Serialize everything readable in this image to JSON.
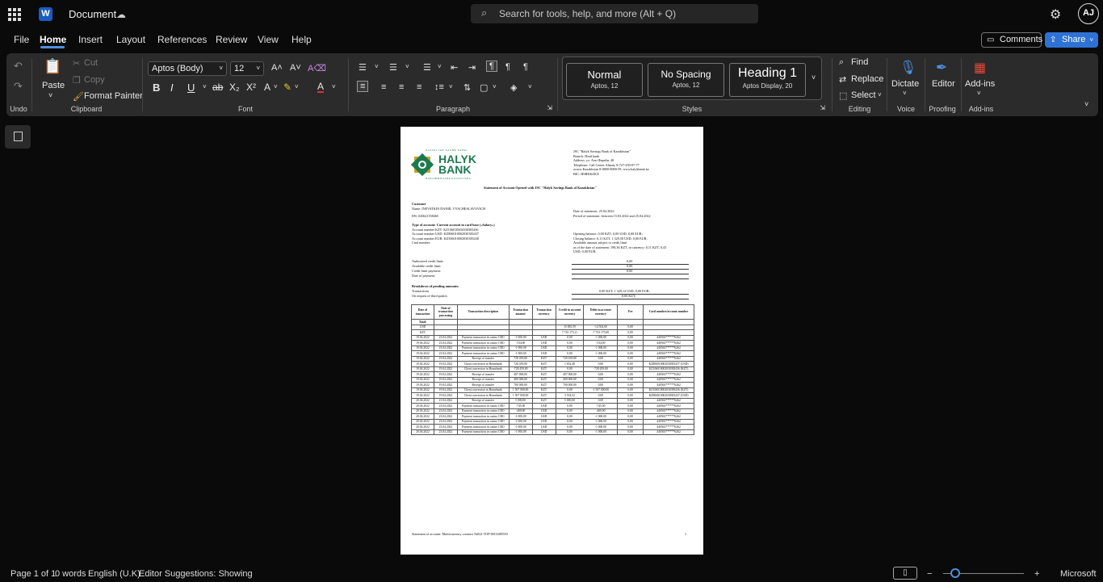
{
  "app": {
    "title": "Document",
    "search_placeholder": "Search for tools, help, and more (Alt + Q)",
    "avatar_initials": "AJ"
  },
  "tabs": [
    "File",
    "Home",
    "Insert",
    "Layout",
    "References",
    "Review",
    "View",
    "Help"
  ],
  "actions": {
    "comments": "Comments",
    "share": "Share"
  },
  "ribbon": {
    "undo_label": "Undo",
    "clipboard": {
      "label": "Clipboard",
      "paste": "Paste",
      "cut": "Cut",
      "copy": "Copy",
      "format_painter": "Format Painter"
    },
    "font": {
      "label": "Font",
      "name": "Aptos (Body)",
      "size": "12"
    },
    "paragraph": {
      "label": "Paragraph"
    },
    "styles": {
      "label": "Styles",
      "items": [
        {
          "name": "Normal",
          "sub": "Aptos, 12"
        },
        {
          "name": "No Spacing",
          "sub": "Aptos, 12"
        },
        {
          "name": "Heading 1",
          "sub": "Aptos Display, 20"
        }
      ]
    },
    "editing": {
      "label": "Editing",
      "find": "Find",
      "replace": "Replace",
      "select": "Select"
    },
    "voice": {
      "label": "Voice",
      "dictate": "Dictate"
    },
    "proofing": {
      "label": "Proofing",
      "editor": "Editor"
    },
    "addins": {
      "label": "Add-ins",
      "btn": "Add-ins"
    }
  },
  "doc": {
    "logo_top": "ҚАЗАҚСТАН ХАЛЫҚ БАНКІ",
    "logo_line1": "HALYK",
    "logo_line2": "BANK",
    "logo_bottom": "НАРОДНЫЙ БАНК КАЗАХСТАНА",
    "bank_info": [
      "JSC \"Halyk Savings Bank of Kazakhstan\"",
      "Branch: Head bank",
      "Address: ул. Аль-Фараби, 40",
      "Telephone: Call Center Almaty 8-727-259-07-77",
      "across Kazakhstan 8-0800-8000-59, www.halykbank.kz",
      "BIC: HSBKKZKX"
    ],
    "heading": "Statement of Account Opened with JSC \"Halyk Savings Bank of Kazakhstan\"",
    "customer": [
      "Customer",
      "Name: INEVATKIN DANIIL VYACHESLAVOVICH",
      "IIN: 020621558465"
    ],
    "date_statement": "Date of statement: 25.04.2022",
    "period": "Period of statement: between 15.03.2022 and 25.04.2022",
    "account_type": "Type of account: Current account in card base («Salary»)",
    "accounts": [
      "Account number KZT: KZ106010002030383436",
      "Account number USD: KZ806010002030383437",
      "Account number EUR: KZ506010002030383438",
      "Card number:"
    ],
    "balances": [
      "Opening balance: 0,00 KZT; 0,00 USD; 0,00 EUR;",
      "Closing balance: 0,11 KZT; 1 329,58 USD; 0,00 EUR;",
      "Available amount subject to credit limit",
      "as of the date of statement: 198,36 KZT, in currency: 0,11 KZT; 0,43",
      "USD; 0,00 EUR;"
    ],
    "credit_labels": [
      "Authorized credit limit:",
      "Available credit limit:",
      "Credit limit payment:",
      "Date of payment:"
    ],
    "credit_values": [
      "0,00",
      "0,00",
      "0,00",
      ""
    ],
    "pending_title": "Breakdown of pending amounts:",
    "pending_labels": [
      "Transactions",
      "On request of third parties"
    ],
    "pending_values": [
      "0,00 KZT; 1 329,14 USD; 0,00 EUR;",
      "0,00 KZT;"
    ],
    "table_headers": [
      "Date of transaction",
      "Date of transaction processing",
      "Transaction description",
      "Transaction amount",
      "Transaction currency",
      "Credit in account currency",
      "Debit in account currency",
      "Fee",
      "Card number/account number"
    ],
    "total_label": "Total:",
    "totals": [
      [
        "USD",
        "",
        "",
        "",
        "",
        "15 835,59",
        "-14 504,00",
        "0,00",
        ""
      ],
      [
        "KZT",
        "",
        "",
        "",
        "",
        "7 733 175,11",
        "-7 733 175,00",
        "0,00",
        ""
      ]
    ],
    "rows": [
      [
        "19.04.2022",
        "23.04.2022",
        "Payment transaction in casino CRO",
        "-1 000,00",
        "USD",
        "0,00",
        "-1 000,00",
        "0,00",
        "440563******6262"
      ],
      [
        "19.04.2022",
        "23.04.2022",
        "Payment transaction in casino CRO",
        "-534,00",
        "USD",
        "0,00",
        "-534,00",
        "0,00",
        "440563******6262"
      ],
      [
        "19.04.2022",
        "23.04.2022",
        "Payment transaction in casino CRO",
        "-1 000,00",
        "USD",
        "0,00",
        "-1 000,00",
        "0,00",
        "440563******6262"
      ],
      [
        "19.04.2022",
        "23.04.2022",
        "Payment transaction in casino CRO",
        "-1 000,00",
        "USD",
        "0,00",
        "-1 000,00",
        "0,00",
        "440563******6262"
      ],
      [
        "19.04.2022",
        "19.04.2022",
        "Receipt of transfer",
        "728 459,00",
        "KZT",
        "728 459,00",
        "0,00",
        "0,00",
        "440563******6262"
      ],
      [
        "19.04.2022",
        "19.04.2022",
        "Client conversion in Homebank",
        "728 459,00",
        "KZT",
        "1 652,48",
        "0,00",
        "0,00",
        "KZ806010002030383437 (USD)"
      ],
      [
        "19.04.2022",
        "19.04.2022",
        "Client conversion in Homebank",
        "-728 459,00",
        "KZT",
        "0,00",
        "-728 459,00",
        "0,00",
        "KZ106010002030383436 (KZT)"
      ],
      [
        "19.04.2022",
        "19.04.2022",
        "Receipt of transfer",
        "407 000,00",
        "KZT",
        "407 000,00",
        "0,00",
        "0,00",
        "440563******6262"
      ],
      [
        "19.04.2022",
        "19.04.2022",
        "Receipt of transfer",
        "400 000,00",
        "KZT",
        "400 000,00",
        "0,00",
        "0,00",
        "440563******6262"
      ],
      [
        "19.04.2022",
        "19.04.2022",
        "Receipt of transfer",
        "700 000,00",
        "KZT",
        "700 000,00",
        "0,00",
        "0,00",
        "440563******6262"
      ],
      [
        "19.04.2022",
        "19.04.2022",
        "Client conversion in Homebank",
        "1 507 000,00",
        "KZT",
        "0,00",
        "-1 507 000,00",
        "0,00",
        "KZ106010002030383436 (KZT)"
      ],
      [
        "19.04.2022",
        "19.04.2022",
        "Client conversion in Homebank",
        "1 507 000,00",
        "KZT",
        "3 534,52",
        "0,00",
        "0,00",
        "KZ806010002030383437 (USD)"
      ],
      [
        "20.04.2022",
        "21.04.2022",
        "Receipt of transfer",
        "5 000,00",
        "KZT",
        "5 000,00",
        "0,00",
        "0,00",
        "440563******6262"
      ],
      [
        "20.04.2022",
        "23.04.2022",
        "Payment transaction in casino CRO",
        "-745,00",
        "USD",
        "0,00",
        "-745,00",
        "0,00",
        "440563******6262"
      ],
      [
        "20.04.2022",
        "23.04.2022",
        "Payment transaction in casino CRO",
        "-400,00",
        "USD",
        "0,00",
        "-400,00",
        "0,00",
        "440563******6262"
      ],
      [
        "20.04.2022",
        "23.04.2022",
        "Payment transaction in casino CRO",
        "-1 000,00",
        "USD",
        "0,00",
        "-1 000,00",
        "0,00",
        "440563******6262"
      ],
      [
        "20.04.2022",
        "23.04.2022",
        "Payment transaction in casino CRO",
        "-1 000,00",
        "USD",
        "0,00",
        "-1 000,00",
        "0,00",
        "440563******6262"
      ],
      [
        "20.04.2022",
        "23.04.2022",
        "Payment transaction in casino CRO",
        "-1 000,00",
        "USD",
        "0,00",
        "-1 000,00",
        "0,00",
        "440563******6262"
      ],
      [
        "20.04.2022",
        "23.04.2022",
        "Payment transaction in casino CRO",
        "-1 000,00",
        "USD",
        "0,00",
        "-1 000,00",
        "0,00",
        "440563******6262"
      ]
    ],
    "footer_left": "Statement of account: Multicurrency contract №022-TOP-MC0485555",
    "footer_page": "1"
  },
  "status": {
    "page": "Page 1 of 1",
    "words": "0 words",
    "language": "English (U.K)",
    "suggestions": "Editor Suggestions: Showing",
    "brand": "Microsoft"
  }
}
